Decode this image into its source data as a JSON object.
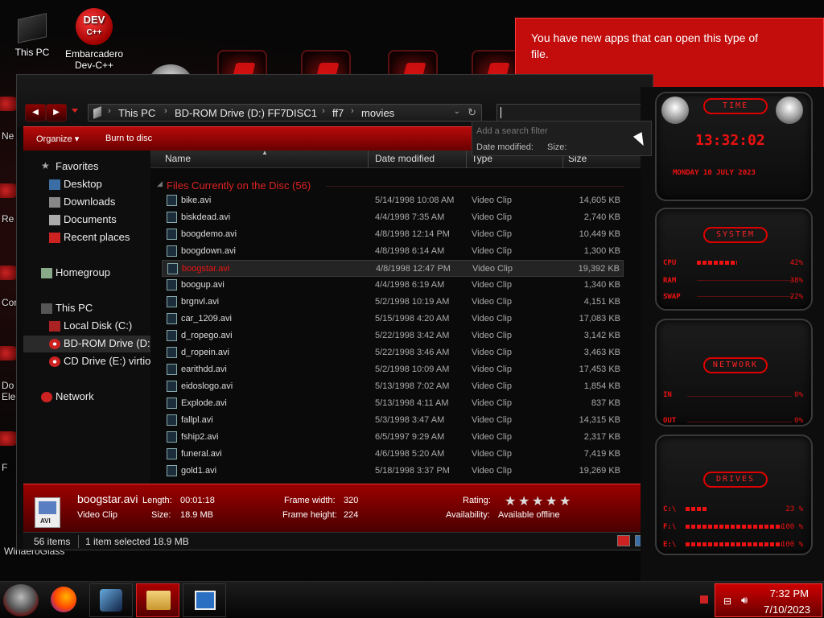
{
  "desktop": {
    "icons": [
      {
        "label": "This PC"
      },
      {
        "label": "Embarcadero\nDev-C++",
        "badge_top": "DEV",
        "badge_bottom": "C++"
      }
    ],
    "edge_labels": [
      "Ne",
      "Re",
      "Con",
      "Do",
      "Ele",
      "F"
    ],
    "bottom_left_label": "WinaeroGlass"
  },
  "notification": {
    "text": "You have new apps that can open this type of file."
  },
  "explorer": {
    "breadcrumb": [
      "This PC",
      "BD-ROM Drive (D:) FF7DISC1",
      "ff7",
      "movies"
    ],
    "search_value": "",
    "search_filter": {
      "hint": "Add a search filter",
      "filter_date": "Date modified:",
      "filter_size": "Size:"
    },
    "commands": [
      "Organize ▾",
      "Burn to disc"
    ],
    "nav": {
      "favorites": "Favorites",
      "favorites_items": [
        "Desktop",
        "Downloads",
        "Documents",
        "Recent places"
      ],
      "homegroup": "Homegroup",
      "thispc": "This PC",
      "drives": [
        "Local Disk (C:)",
        "BD-ROM Drive (D:",
        "CD Drive (E:) virtio"
      ],
      "network": "Network"
    },
    "columns": {
      "name": "Name",
      "date": "Date modified",
      "type": "Type",
      "size": "Size"
    },
    "group_label": "Files Currently on the Disc (56)",
    "files": [
      {
        "name": "bike.avi",
        "date": "5/14/1998 10:08 AM",
        "type": "Video Clip",
        "size": "14,605 KB"
      },
      {
        "name": "biskdead.avi",
        "date": "4/4/1998 7:35 AM",
        "type": "Video Clip",
        "size": "2,740 KB"
      },
      {
        "name": "boogdemo.avi",
        "date": "4/8/1998 12:14 PM",
        "type": "Video Clip",
        "size": "10,449 KB"
      },
      {
        "name": "boogdown.avi",
        "date": "4/8/1998 6:14 AM",
        "type": "Video Clip",
        "size": "1,300 KB"
      },
      {
        "name": "boogstar.avi",
        "date": "4/8/1998 12:47 PM",
        "type": "Video Clip",
        "size": "19,392 KB",
        "selected": true
      },
      {
        "name": "boogup.avi",
        "date": "4/4/1998 6:19 AM",
        "type": "Video Clip",
        "size": "1,340 KB"
      },
      {
        "name": "brgnvl.avi",
        "date": "5/2/1998 10:19 AM",
        "type": "Video Clip",
        "size": "4,151 KB"
      },
      {
        "name": "car_1209.avi",
        "date": "5/15/1998 4:20 AM",
        "type": "Video Clip",
        "size": "17,083 KB"
      },
      {
        "name": "d_ropego.avi",
        "date": "5/22/1998 3:42 AM",
        "type": "Video Clip",
        "size": "3,142 KB"
      },
      {
        "name": "d_ropein.avi",
        "date": "5/22/1998 3:46 AM",
        "type": "Video Clip",
        "size": "3,463 KB"
      },
      {
        "name": "earithdd.avi",
        "date": "5/2/1998 10:09 AM",
        "type": "Video Clip",
        "size": "17,453 KB"
      },
      {
        "name": "eidoslogo.avi",
        "date": "5/13/1998 7:02 AM",
        "type": "Video Clip",
        "size": "1,854 KB"
      },
      {
        "name": "Explode.avi",
        "date": "5/13/1998 4:11 AM",
        "type": "Video Clip",
        "size": "837 KB"
      },
      {
        "name": "fallpl.avi",
        "date": "5/3/1998 3:47 AM",
        "type": "Video Clip",
        "size": "14,315 KB"
      },
      {
        "name": "fship2.avi",
        "date": "6/5/1997 9:29 AM",
        "type": "Video Clip",
        "size": "2,317 KB"
      },
      {
        "name": "funeral.avi",
        "date": "4/6/1998 5:20 AM",
        "type": "Video Clip",
        "size": "7,419 KB"
      },
      {
        "name": "gold1.avi",
        "date": "5/18/1998 3:37 PM",
        "type": "Video Clip",
        "size": "19,269 KB"
      }
    ],
    "details": {
      "filename": "boogstar.avi",
      "filetype": "Video Clip",
      "thumb_ext": "AVI",
      "length_label": "Length:",
      "length": "00:01:18",
      "size_label": "Size:",
      "size": "18.9 MB",
      "fw_label": "Frame width:",
      "frame_width": "320",
      "fh_label": "Frame height:",
      "frame_height": "224",
      "rating_label": "Rating:",
      "rating": 0,
      "avail_label": "Availability:",
      "availability": "Available offline"
    },
    "status": {
      "items": "56 items",
      "selected": "1 item selected  18.9 MB"
    }
  },
  "gadget": {
    "time_title": "TIME",
    "time": "13:32:02",
    "date": "MONDAY 10 JULY 2023",
    "system_title": "SYSTEM",
    "system": [
      {
        "label": "CPU",
        "pct": "42%",
        "level": 0.42
      },
      {
        "label": "RAM",
        "pct": "38%",
        "level": 0.38
      },
      {
        "label": "SWAP",
        "pct": "22%",
        "level": 0.22
      }
    ],
    "network_title": "NETWORK",
    "network": [
      {
        "label": "IN",
        "pct": "0%"
      },
      {
        "label": "OUT",
        "pct": "0%"
      }
    ],
    "drives_title": "DRIVES",
    "drives": [
      {
        "label": "C:\\",
        "pct": "23 %",
        "level": 0.23
      },
      {
        "label": "F:\\",
        "pct": "100 %",
        "level": 1.0
      },
      {
        "label": "E:\\",
        "pct": "100 %",
        "level": 1.0
      }
    ]
  },
  "taskbar": {
    "time": "7:32 PM",
    "date": "7/10/2023"
  },
  "colors": {
    "accent": "#c30d0d",
    "dark": "#0c0c0c"
  }
}
